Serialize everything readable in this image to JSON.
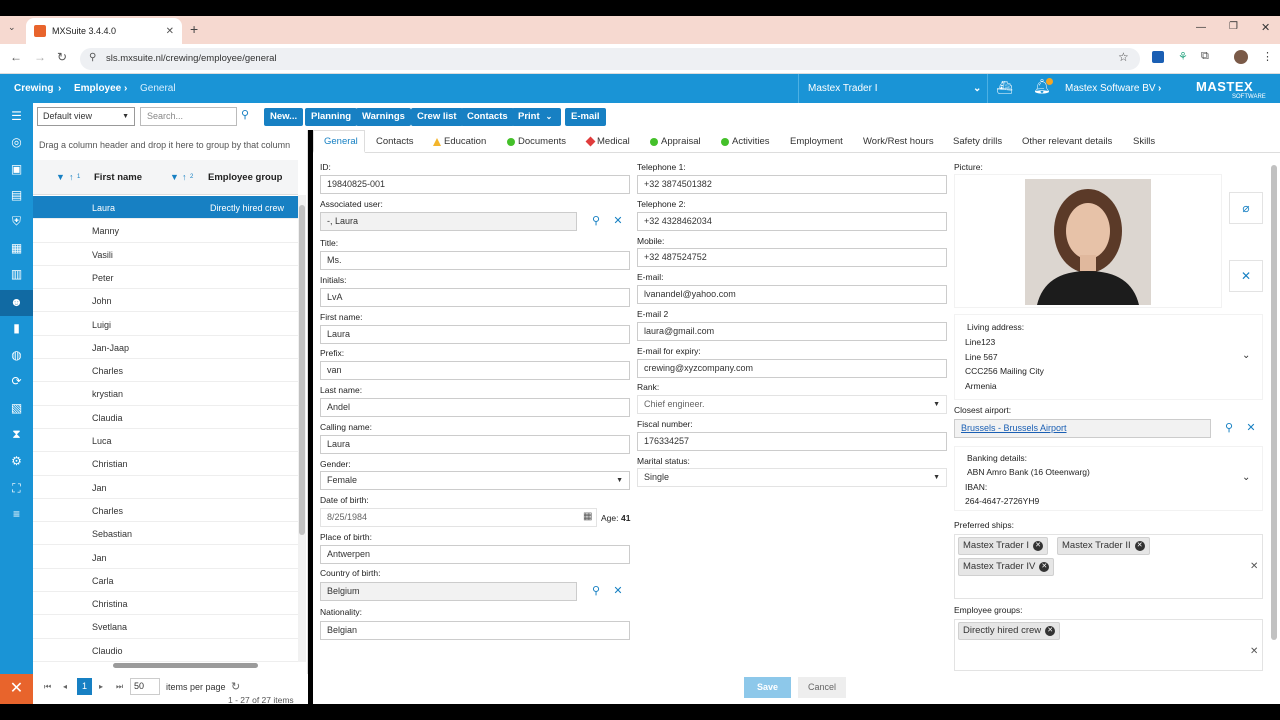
{
  "browser": {
    "tab_title": "MXSuite 3.4.4.0",
    "url": "sls.mxsuite.nl/crewing/employee/general"
  },
  "header": {
    "crumbs": [
      "Crewing",
      "Employee",
      "General"
    ],
    "ship": "Mastex Trader I",
    "company": "Mastex Software BV",
    "logo": "MASTEX",
    "logo_sub": "SOFTWARE"
  },
  "toolbar": {
    "view": "Default view",
    "search_placeholder": "Search...",
    "buttons": [
      "New...",
      "Planning",
      "Warnings",
      "Crew list",
      "Contacts",
      "Print",
      "E-mail"
    ]
  },
  "grid": {
    "group_hint": "Drag a column header and drop it here to group by that column",
    "col_first": "First name",
    "col_group": "Employee group",
    "sort1": "1",
    "sort2": "2",
    "rows": [
      {
        "name": "Laura",
        "group": "Directly hired crew"
      },
      {
        "name": "Manny",
        "group": ""
      },
      {
        "name": "Vasili",
        "group": ""
      },
      {
        "name": "Peter",
        "group": ""
      },
      {
        "name": "John",
        "group": ""
      },
      {
        "name": "Luigi",
        "group": ""
      },
      {
        "name": "Jan-Jaap",
        "group": ""
      },
      {
        "name": "Charles",
        "group": ""
      },
      {
        "name": "krystian",
        "group": ""
      },
      {
        "name": "Claudia",
        "group": ""
      },
      {
        "name": "Luca",
        "group": ""
      },
      {
        "name": "Christian",
        "group": ""
      },
      {
        "name": "Jan",
        "group": ""
      },
      {
        "name": "Charles",
        "group": ""
      },
      {
        "name": "Sebastian",
        "group": ""
      },
      {
        "name": "Jan",
        "group": ""
      },
      {
        "name": "Carla",
        "group": ""
      },
      {
        "name": "Christina",
        "group": ""
      },
      {
        "name": "Svetlana",
        "group": ""
      },
      {
        "name": "Claudio",
        "group": ""
      }
    ],
    "page": "1",
    "page_size": "50",
    "items_per_page": "items per page",
    "range": "1 - 27 of 27 items"
  },
  "tabs": [
    "General",
    "Contacts",
    "Education",
    "Documents",
    "Medical",
    "Appraisal",
    "Activities",
    "Employment",
    "Work/Rest hours",
    "Safety drills",
    "Other relevant details",
    "Skills"
  ],
  "form": {
    "id_label": "ID:",
    "id": "19840825-001",
    "user_label": "Associated user:",
    "user": "-, Laura",
    "title_label": "Title:",
    "title": "Ms.",
    "initials_label": "Initials:",
    "initials": "LvA",
    "first_label": "First name:",
    "first": "Laura",
    "prefix_label": "Prefix:",
    "prefix": "van",
    "last_label": "Last name:",
    "last": "Andel",
    "calling_label": "Calling name:",
    "calling": "Laura",
    "gender_label": "Gender:",
    "gender": "Female",
    "dob_label": "Date of birth:",
    "dob": "8/25/1984",
    "age_label": "Age:",
    "age": "41",
    "pob_label": "Place of birth:",
    "pob": "Antwerpen",
    "cob_label": "Country of birth:",
    "cob": "Belgium",
    "nat_label": "Nationality:",
    "nat": "Belgian",
    "tel1_label": "Telephone 1:",
    "tel1": "+32 3874501382",
    "tel2_label": "Telephone 2:",
    "tel2": "+32 4328462034",
    "mobile_label": "Mobile:",
    "mobile": "+32 487524752",
    "email_label": "E-mail:",
    "email": "lvanandel@yahoo.com",
    "email2_label": "E-mail 2",
    "email2": "laura@gmail.com",
    "expiry_label": "E-mail for expiry:",
    "expiry": "crewing@xyzcompany.com",
    "rank_label": "Rank:",
    "rank": "Chief engineer.",
    "fiscal_label": "Fiscal number:",
    "fiscal": "176334257",
    "marital_label": "Marital status:",
    "marital": "Single",
    "picture_label": "Picture:",
    "living_label": "Living address:",
    "address": [
      "Line123",
      "Line 567",
      "CCC256 Mailing City",
      "Armenia"
    ],
    "airport_label": "Closest airport:",
    "airport": "Brussels - Brussels Airport",
    "bank_label": "Banking details:",
    "bank": "ABN Amro Bank (16 Oteenwarg)",
    "iban_label": "IBAN:",
    "iban": "264-4647-2726YH9",
    "ships_label": "Preferred ships:",
    "ships": [
      "Mastex Trader I",
      "Mastex Trader II",
      "Mastex Trader IV"
    ],
    "groups_label": "Employee groups:",
    "groups": [
      "Directly hired crew"
    ],
    "save": "Save",
    "cancel": "Cancel"
  },
  "colors": {
    "brand": "#1a94d6",
    "button": "#1780c3",
    "tab_strip": "#f6d9d0"
  }
}
